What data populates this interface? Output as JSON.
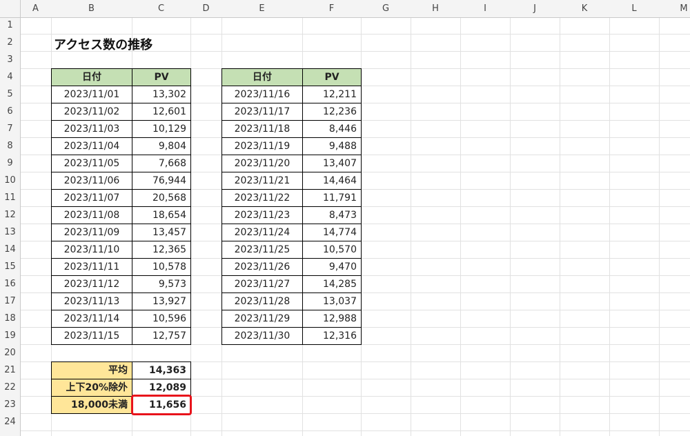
{
  "columns": [
    "A",
    "B",
    "C",
    "D",
    "E",
    "F",
    "G",
    "H",
    "I",
    "J",
    "K",
    "L",
    "M"
  ],
  "rows": [
    "1",
    "2",
    "3",
    "4",
    "5",
    "6",
    "7",
    "8",
    "9",
    "10",
    "11",
    "12",
    "13",
    "14",
    "15",
    "16",
    "17",
    "18",
    "19",
    "20",
    "21",
    "22",
    "23",
    "24"
  ],
  "sheet": {
    "title": "アクセス数の推移",
    "headers": {
      "date": "日付",
      "pv": "PV"
    },
    "table1": [
      [
        "2023/11/01",
        "13,302"
      ],
      [
        "2023/11/02",
        "12,601"
      ],
      [
        "2023/11/03",
        "10,129"
      ],
      [
        "2023/11/04",
        "9,804"
      ],
      [
        "2023/11/05",
        "7,668"
      ],
      [
        "2023/11/06",
        "76,944"
      ],
      [
        "2023/11/07",
        "20,568"
      ],
      [
        "2023/11/08",
        "18,654"
      ],
      [
        "2023/11/09",
        "13,457"
      ],
      [
        "2023/11/10",
        "12,365"
      ],
      [
        "2023/11/11",
        "10,578"
      ],
      [
        "2023/11/12",
        "9,573"
      ],
      [
        "2023/11/13",
        "13,927"
      ],
      [
        "2023/11/14",
        "10,596"
      ],
      [
        "2023/11/15",
        "12,757"
      ]
    ],
    "table2": [
      [
        "2023/11/16",
        "12,211"
      ],
      [
        "2023/11/17",
        "12,236"
      ],
      [
        "2023/11/18",
        "8,446"
      ],
      [
        "2023/11/19",
        "9,488"
      ],
      [
        "2023/11/20",
        "13,407"
      ],
      [
        "2023/11/21",
        "14,464"
      ],
      [
        "2023/11/22",
        "11,791"
      ],
      [
        "2023/11/23",
        "8,473"
      ],
      [
        "2023/11/24",
        "14,774"
      ],
      [
        "2023/11/25",
        "10,570"
      ],
      [
        "2023/11/26",
        "9,470"
      ],
      [
        "2023/11/27",
        "14,285"
      ],
      [
        "2023/11/28",
        "13,037"
      ],
      [
        "2023/11/29",
        "12,988"
      ],
      [
        "2023/11/30",
        "12,316"
      ]
    ],
    "summary": [
      [
        "平均",
        "14,363"
      ],
      [
        "上下20%除外",
        "12,089"
      ],
      [
        "18,000未満",
        "11,656"
      ]
    ],
    "highlight_color": "#e8131b"
  }
}
